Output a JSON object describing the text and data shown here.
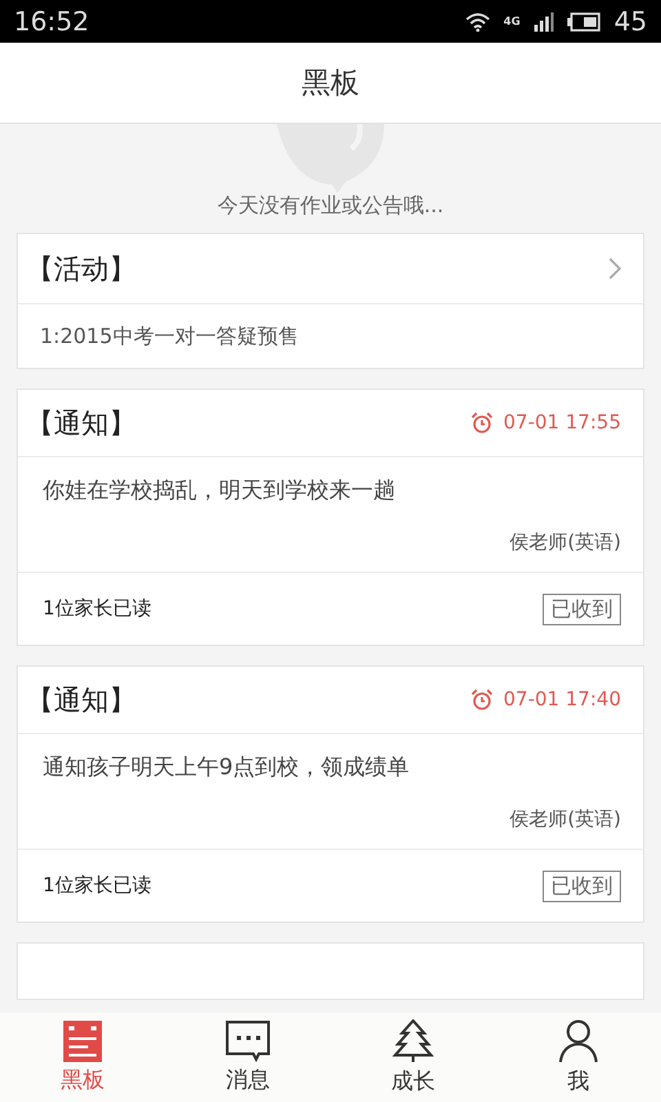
{
  "status_bar": {
    "time": "16:52",
    "network": "4G",
    "battery": "45"
  },
  "header": {
    "title": "黑板"
  },
  "empty_message": "今天没有作业或公告哦...",
  "activity": {
    "title": "【活动】",
    "items": [
      "1:2015中考一对一答疑预售"
    ]
  },
  "notices": [
    {
      "title": "【通知】",
      "time": "07-01 17:55",
      "text": "你娃在学校捣乱，明天到学校来一趟",
      "author": "侯老师(英语)",
      "read_count": "1位家长已读",
      "action": "已收到"
    },
    {
      "title": "【通知】",
      "time": "07-01 17:40",
      "text": "通知孩子明天上午9点到校，领成绩单",
      "author": "侯老师(英语)",
      "read_count": "1位家长已读",
      "action": "已收到"
    }
  ],
  "tabs": [
    {
      "label": "黑板",
      "selected": true
    },
    {
      "label": "消息",
      "selected": false
    },
    {
      "label": "成长",
      "selected": false
    },
    {
      "label": "我",
      "selected": false
    }
  ]
}
